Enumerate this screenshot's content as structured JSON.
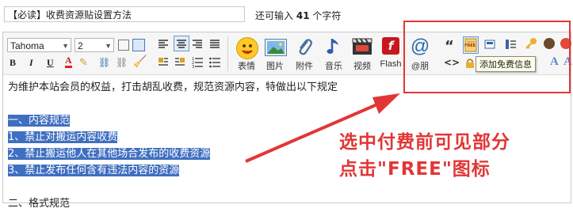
{
  "title": {
    "value": "【必读】收费资源贴设置方法",
    "hint_prefix": "还可输入",
    "hint_count": "41",
    "hint_suffix": "个字符"
  },
  "toolbar": {
    "font_family": "Tahoma",
    "font_size": "2",
    "format_buttons": [
      "B",
      "I",
      "U",
      "A"
    ],
    "media_buttons": [
      {
        "label": "表情",
        "icon": "smiley-icon"
      },
      {
        "label": "图片",
        "icon": "image-icon"
      },
      {
        "label": "附件",
        "icon": "paperclip-icon"
      },
      {
        "label": "音乐",
        "icon": "music-note-icon"
      },
      {
        "label": "视频",
        "icon": "video-icon"
      },
      {
        "label": "Flash",
        "icon": "flash-icon"
      },
      {
        "label": "@朋",
        "icon": "at-icon"
      }
    ],
    "quote_glyph": "“",
    "code_glyph": "<>",
    "free_icon_text": "FREE",
    "tooltip": "添加免费信息"
  },
  "content": {
    "lines": [
      {
        "text": "为维护本站会员的权益，打击胡乱收费，规范资源内容，特做出以下规定",
        "selected": false
      },
      {
        "text": "",
        "selected": false
      },
      {
        "text": "一、内容规范",
        "selected": true
      },
      {
        "text": "1、禁止对搬运内容收费",
        "selected": true
      },
      {
        "text": "2、禁止搬运他人在其他场合发布的收费资源",
        "selected": true
      },
      {
        "text": "3、禁止发布任何含有违法内容的资源",
        "selected": true
      },
      {
        "text": "",
        "selected": false
      },
      {
        "text": "二、格式规范",
        "selected": false
      }
    ]
  },
  "annotation": {
    "line1": "选中付费前可见部分",
    "line2": "点击\"FREE\"图标",
    "color": "#e23636"
  }
}
